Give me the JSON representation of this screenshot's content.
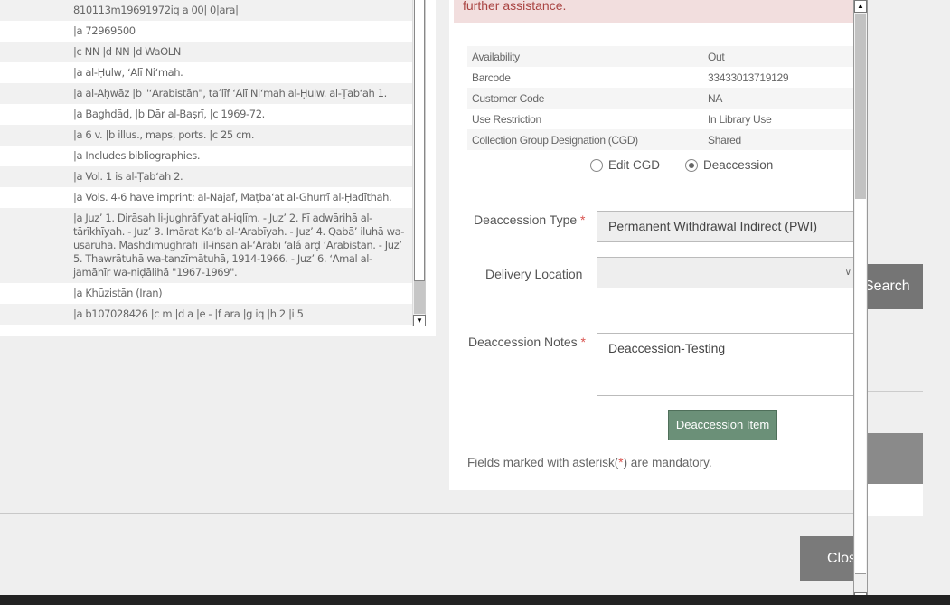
{
  "marc": {
    "rows": [
      "810113m19691972iq a 00| 0|ara|",
      "|a 72969500",
      "|c NN |d NN |d WaOLN",
      "|a al-Ḥulw, ʻAlī Niʻmah.",
      "|a al-Aḥwāz |b \"ʻArabistān\", taʼlīf ʻAlī Niʻmah al-Ḥulw. al-Ṭabʻah 1.",
      "|a Baghdād, |b Dār al-Baṣrī, |c 1969-72.",
      "|a 6 v. |b illus., maps, ports. |c 25 cm.",
      "|a Includes bibliographies.",
      "|a Vol. 1 is al-Ṭabʻah 2.",
      "|a Vols. 4-6 have imprint: al-Najaf, Maṭbaʻat al-Ghurrī al-Ḥadīthah.",
      "|a Juzʼ 1. Dirāsah li-jughrāfīyat al-iqlīm. - Juzʼ 2. Fī adwārihā al-tārīkhīyah. - Juzʼ 3. Imārat Kaʻb al-ʻArabīyah. - Juzʼ 4. Qabāʼ iluhā wa-usaruhā. Mashdīmūghrāfī lil-insān al-ʻArabī ʻalá arḍ ʻArabistān. - Juzʼ 5. Thawrātuhā wa-tanẓīmātuhā, 1914-1966. - Juzʼ 6. ʻAmal al-jamāhīr wa-niḍālihā \"1967-1969\".",
      "|a Khūzistān (Iran)",
      "|a b107028426 |c m |d a |e - |f ara |g iq |h 2 |i 5"
    ]
  },
  "alert": {
    "text": "further assistance."
  },
  "info": {
    "rows": [
      {
        "label": "Availability",
        "value": "Out"
      },
      {
        "label": "Barcode",
        "value": "33433013719129"
      },
      {
        "label": "Customer Code",
        "value": "NA"
      },
      {
        "label": "Use Restriction",
        "value": "In Library Use"
      },
      {
        "label": "Collection Group Designation (CGD)",
        "value": "Shared"
      }
    ]
  },
  "radios": {
    "edit_cgd": "Edit CGD",
    "deaccession": "Deaccession",
    "selected": "deaccession"
  },
  "form": {
    "deaccession_type_label": "Deaccession Type",
    "deaccession_type_value": "Permanent Withdrawal Indirect (PWI)",
    "delivery_location_label": "Delivery Location",
    "delivery_location_value": "",
    "notes_label": "Deaccession Notes",
    "notes_value": "Deaccession-Testing",
    "required_mark": "*",
    "submit_label": "Deaccession Item",
    "footnote_pre": "Fields marked with asterisk(",
    "footnote_post": ") are mandatory."
  },
  "background": {
    "search_label": "Search"
  },
  "modal": {
    "close_label": "Close"
  }
}
